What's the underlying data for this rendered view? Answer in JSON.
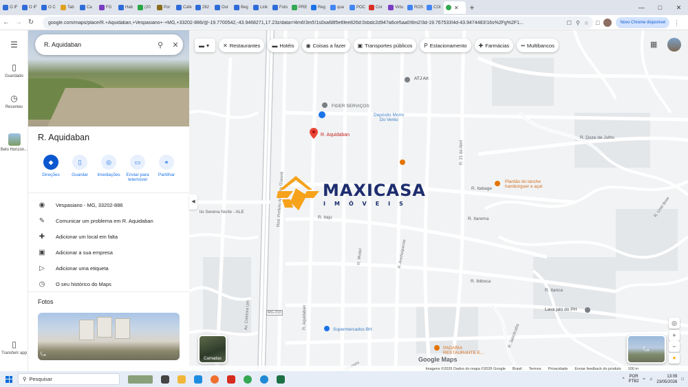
{
  "browser": {
    "tabs": [
      {
        "label": "O IF",
        "color": "#2f6cd8"
      },
      {
        "label": "O IF",
        "color": "#2f6cd8"
      },
      {
        "label": "O C",
        "color": "#2f6cd8"
      },
      {
        "label": "Tab",
        "color": "#e0a020"
      },
      {
        "label": "Ca",
        "color": "#2f6cd8"
      },
      {
        "label": "FG",
        "color": "#7a3dc1"
      },
      {
        "label": "Hab",
        "color": "#2f6cd8"
      },
      {
        "label": "(20",
        "color": "#27a844"
      },
      {
        "label": "Por",
        "color": "#8a6d1c"
      },
      {
        "label": "Cafe",
        "color": "#2f6cd8"
      },
      {
        "label": "262",
        "color": "#2f6cd8"
      },
      {
        "label": "Our",
        "color": "#2f6cd8"
      },
      {
        "label": "Beg",
        "color": "#2f6cd8"
      },
      {
        "label": "Link",
        "color": "#2f6cd8"
      },
      {
        "label": "Foto",
        "color": "#2f6cd8"
      },
      {
        "label": "PRE",
        "color": "#34a853"
      },
      {
        "label": "Reg",
        "color": "#1a73e8"
      },
      {
        "label": "qua",
        "color": "#4285f4"
      },
      {
        "label": "POC",
        "color": "#4285f4"
      },
      {
        "label": "Cor",
        "color": "#d93025"
      },
      {
        "label": "Virtu",
        "color": "#7a3dc1"
      },
      {
        "label": "ROS",
        "color": "#4285f4"
      },
      {
        "label": "COI",
        "color": "#4285f4"
      }
    ],
    "active_tab_color": "#34a853",
    "new_tab": "+",
    "url": "google.com/maps/place/R.+Aquidaban,+Vespasiano+-+MG,+33202-886/@-19.7700542,-43.9468271,17.23z/data=!4m6!3m5!1s0xa68f5e6fee826d:0xbdc2d947a6ce5aa0!8m2!3d-19.767533!4d-43.9474483!16s%2Fg%2F1...",
    "update_label": "Novo Chrome disponível"
  },
  "rail": {
    "menu_icon": "menu-icon",
    "saved": "Guardado",
    "recents": "Recentes",
    "place": "Belo Horizon...",
    "transfer": "Transferir app"
  },
  "search": {
    "value": "R. Aquidaban"
  },
  "place": {
    "title": "R. Aquidaban",
    "actions": [
      {
        "label": "Direções",
        "icon": "directions-icon"
      },
      {
        "label": "Guardar",
        "icon": "bookmark-icon"
      },
      {
        "label": "Imediações",
        "icon": "nearby-icon"
      },
      {
        "label": "Enviar para telemóvel",
        "icon": "send-to-phone-icon"
      },
      {
        "label": "Partilhar",
        "icon": "share-icon"
      }
    ],
    "info": [
      {
        "label": "Vespasiano - MG, 33202-886",
        "icon": "location-icon"
      },
      {
        "label": "Comunicar um problema em R. Aquidaban",
        "icon": "edit-icon"
      },
      {
        "label": "Adicionar um local em falta",
        "icon": "add-place-icon"
      },
      {
        "label": "Adicionar a sua empresa",
        "icon": "store-icon"
      },
      {
        "label": "Adicionar uma etiqueta",
        "icon": "label-icon"
      },
      {
        "label": "O seu histórico do Maps",
        "icon": "history-icon"
      }
    ],
    "photos_label": "Fotos"
  },
  "map": {
    "chips": [
      {
        "label": "Restaurantes",
        "icon": "restaurant-icon"
      },
      {
        "label": "Hotéis",
        "icon": "hotel-icon"
      },
      {
        "label": "Coisas a fazer",
        "icon": "camera-icon"
      },
      {
        "label": "Transportes públicos",
        "icon": "bus-icon"
      },
      {
        "label": "Estacionamento",
        "icon": "parking-icon"
      },
      {
        "label": "Farmácias",
        "icon": "pharmacy-icon"
      },
      {
        "label": "Multibancos",
        "icon": "atm-icon"
      }
    ],
    "pin_label": "R. Aquidaban",
    "labels": {
      "atj": "ATJ Art",
      "fider": "FIDER SERVIÇOS",
      "deposito": "Depósito Morro\nDo Vento",
      "plantao": "Plantão do lanche\nhambúrguer e açaí",
      "lavajato": "Lava jato do PH",
      "super": "Supermercados BH",
      "padaria": "PADARIA\nRESTAURANTE E...",
      "serena": "lio Serena Norte - ALE",
      "mg010": "MG-010",
      "itaju": "R. Itaju",
      "aquidaban": "R. Aquidaban",
      "coletora": "Av. Coletora Um",
      "rodovia": "Rod. Prefeito Américo Gianetti",
      "muqui": "R. Muqui",
      "uirapuru": "R. Uirapuru",
      "anchuqueras": "R. Anchuqueras",
      "abril": "R. 21 de Abril",
      "itabage": "R. Itabage",
      "itarema": "R. Itarema",
      "ibiboca": "R. Ibiboca",
      "itanca": "R. Itanca",
      "jaboticaba": "R. Jaboticaba",
      "doze": "R. Doze de Julho",
      "urpel": "R. Uriel Bree"
    },
    "logo": {
      "name": "MAXICASA",
      "sub": "IMÓVEIS"
    },
    "layers_label": "Camadas",
    "google_logo": "Google Maps",
    "footer": [
      "Imagens ©2026 Dados do mapa ©2026 Google",
      "Brasil",
      "Termos",
      "Privacidade",
      "Enviar feedback do produto",
      "100 m"
    ]
  },
  "taskbar": {
    "search": "Pesquisar",
    "lang1": "POR",
    "lang2": "PTB2",
    "time": "13:09",
    "date": "23/05/2026"
  }
}
